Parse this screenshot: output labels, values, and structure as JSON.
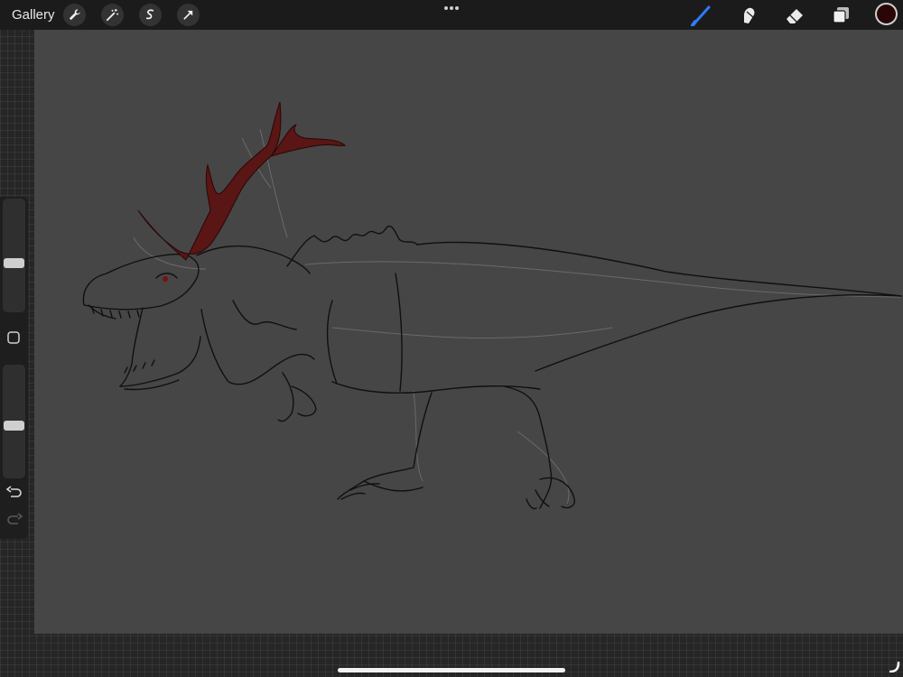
{
  "toolbar": {
    "gallery_label": "Gallery",
    "left_tools": [
      "wrench-icon",
      "magic-wand-icon",
      "selection-icon",
      "transform-icon"
    ],
    "more_icon": "more-dots-icon",
    "right_tools": [
      "brush-icon",
      "smudge-icon",
      "eraser-icon",
      "layers-icon"
    ],
    "brush_active_color": "#2b7cf5",
    "current_color": "#2a0606"
  },
  "sidebar": {
    "brush_size_level": 0.54,
    "opacity_level": 0.46,
    "modify_icon": "square-modifier-icon",
    "undo_icon": "undo-icon",
    "redo_icon": "redo-icon"
  },
  "canvas": {
    "background": "#464646",
    "artwork": "dinosaur-sketch-with-antlers",
    "antler_color": "#5a1515"
  }
}
